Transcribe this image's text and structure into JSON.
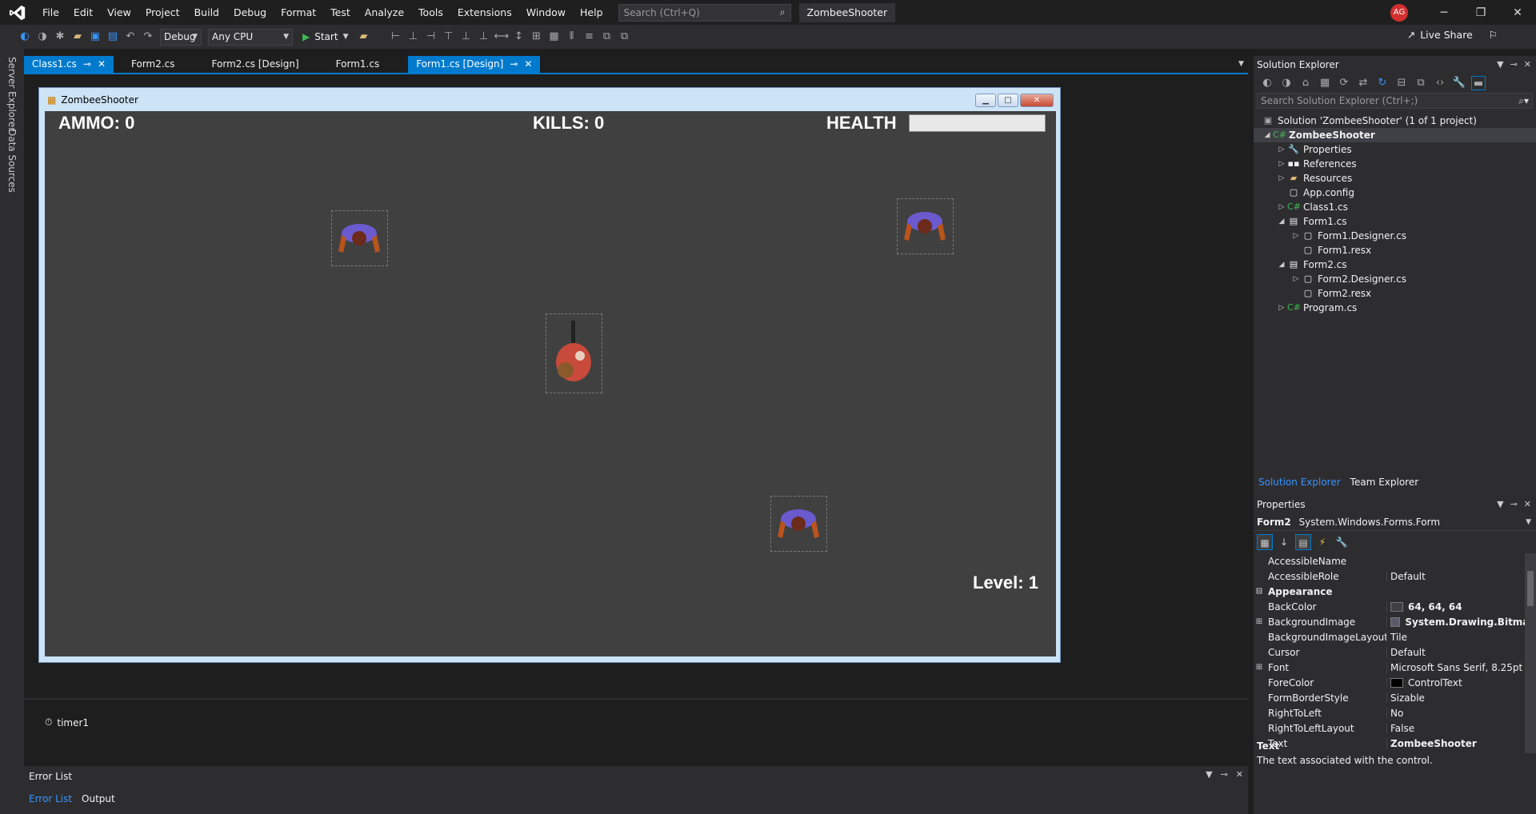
{
  "menubar": {
    "items": [
      "File",
      "Edit",
      "View",
      "Project",
      "Build",
      "Debug",
      "Format",
      "Test",
      "Analyze",
      "Tools",
      "Extensions",
      "Window",
      "Help"
    ],
    "search_placeholder": "Search (Ctrl+Q)",
    "project_title": "ZombeeShooter",
    "avatar_initials": "AG"
  },
  "toolbar": {
    "config": "Debug",
    "platform": "Any CPU",
    "start_label": "Start",
    "live_share": "Live Share"
  },
  "left_rail": {
    "server_explorer": "Server Explorer",
    "data_sources": "Data Sources"
  },
  "tabs": [
    {
      "label": "Class1.cs"
    },
    {
      "label": "Form2.cs"
    },
    {
      "label": "Form2.cs [Design]"
    },
    {
      "label": "Form1.cs"
    },
    {
      "label": "Form1.cs [Design]"
    }
  ],
  "form": {
    "title": "ZombeeShooter",
    "ammo": "AMMO: 0",
    "kills": "KILLS: 0",
    "health": "HEALTH",
    "level": "Level: 1",
    "backcolor": "#404040"
  },
  "tray": {
    "timer": "timer1"
  },
  "bottom": {
    "title": "Error List",
    "tabs": [
      "Error List",
      "Output"
    ]
  },
  "solution_explorer": {
    "title": "Solution Explorer",
    "search_placeholder": "Search Solution Explorer (Ctrl+;)",
    "tree": [
      "Solution 'ZombeeShooter' (1 of 1 project)",
      "ZombeeShooter",
      "Properties",
      "References",
      "Resources",
      "App.config",
      "Class1.cs",
      "Form1.cs",
      "Form1.Designer.cs",
      "Form1.resx",
      "Form2.cs",
      "Form2.Designer.cs",
      "Form2.resx",
      "Program.cs"
    ],
    "bottom_tabs": [
      "Solution Explorer",
      "Team Explorer"
    ]
  },
  "properties": {
    "title": "Properties",
    "object_name": "Form2",
    "object_type": "System.Windows.Forms.Form",
    "rows": [
      {
        "name": "AccessibleName",
        "value": ""
      },
      {
        "name": "AccessibleRole",
        "value": "Default"
      },
      {
        "name": "Appearance",
        "value": ""
      },
      {
        "name": "BackColor",
        "value": "64, 64, 64"
      },
      {
        "name": "BackgroundImage",
        "value": "System.Drawing.Bitmap"
      },
      {
        "name": "BackgroundImageLayout",
        "value": "Tile"
      },
      {
        "name": "Cursor",
        "value": "Default"
      },
      {
        "name": "Font",
        "value": "Microsoft Sans Serif, 8.25pt"
      },
      {
        "name": "ForeColor",
        "value": "ControlText"
      },
      {
        "name": "FormBorderStyle",
        "value": "Sizable"
      },
      {
        "name": "RightToLeft",
        "value": "No"
      },
      {
        "name": "RightToLeftLayout",
        "value": "False"
      },
      {
        "name": "Text",
        "value": "ZombeeShooter"
      }
    ],
    "desc_title": "Text",
    "desc_body": "The text associated with the control."
  }
}
